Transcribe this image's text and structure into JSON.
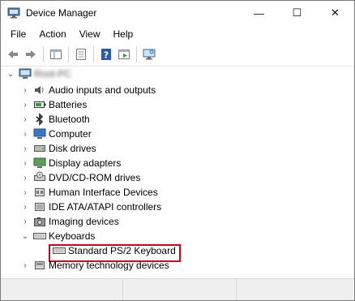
{
  "window": {
    "title": "Device Manager",
    "minimize_glyph": "—",
    "maximize_glyph": "☐",
    "close_glyph": "✕"
  },
  "menu": [
    "File",
    "Action",
    "View",
    "Help"
  ],
  "tree": {
    "root_label": "Root-PC",
    "categories": [
      "Audio inputs and outputs",
      "Batteries",
      "Bluetooth",
      "Computer",
      "Disk drives",
      "Display adapters",
      "DVD/CD-ROM drives",
      "Human Interface Devices",
      "IDE ATA/ATAPI controllers",
      "Imaging devices",
      "Keyboards",
      "Memory technology devices"
    ],
    "keyboard_child": "Standard PS/2 Keyboard"
  },
  "icons": {
    "audio": "speaker-icon",
    "battery": "battery-icon",
    "bluetooth": "bluetooth-icon",
    "computer": "computer-icon",
    "disk": "disk-drive-icon",
    "display": "display-adapter-icon",
    "dvd": "dvd-drive-icon",
    "hid": "hid-icon",
    "ide": "ide-controller-icon",
    "imaging": "camera-icon",
    "keyboard": "keyboard-icon",
    "memory": "memory-card-icon"
  },
  "colors": {
    "highlight": "#d0021b",
    "accent": "#1e6fc9"
  }
}
